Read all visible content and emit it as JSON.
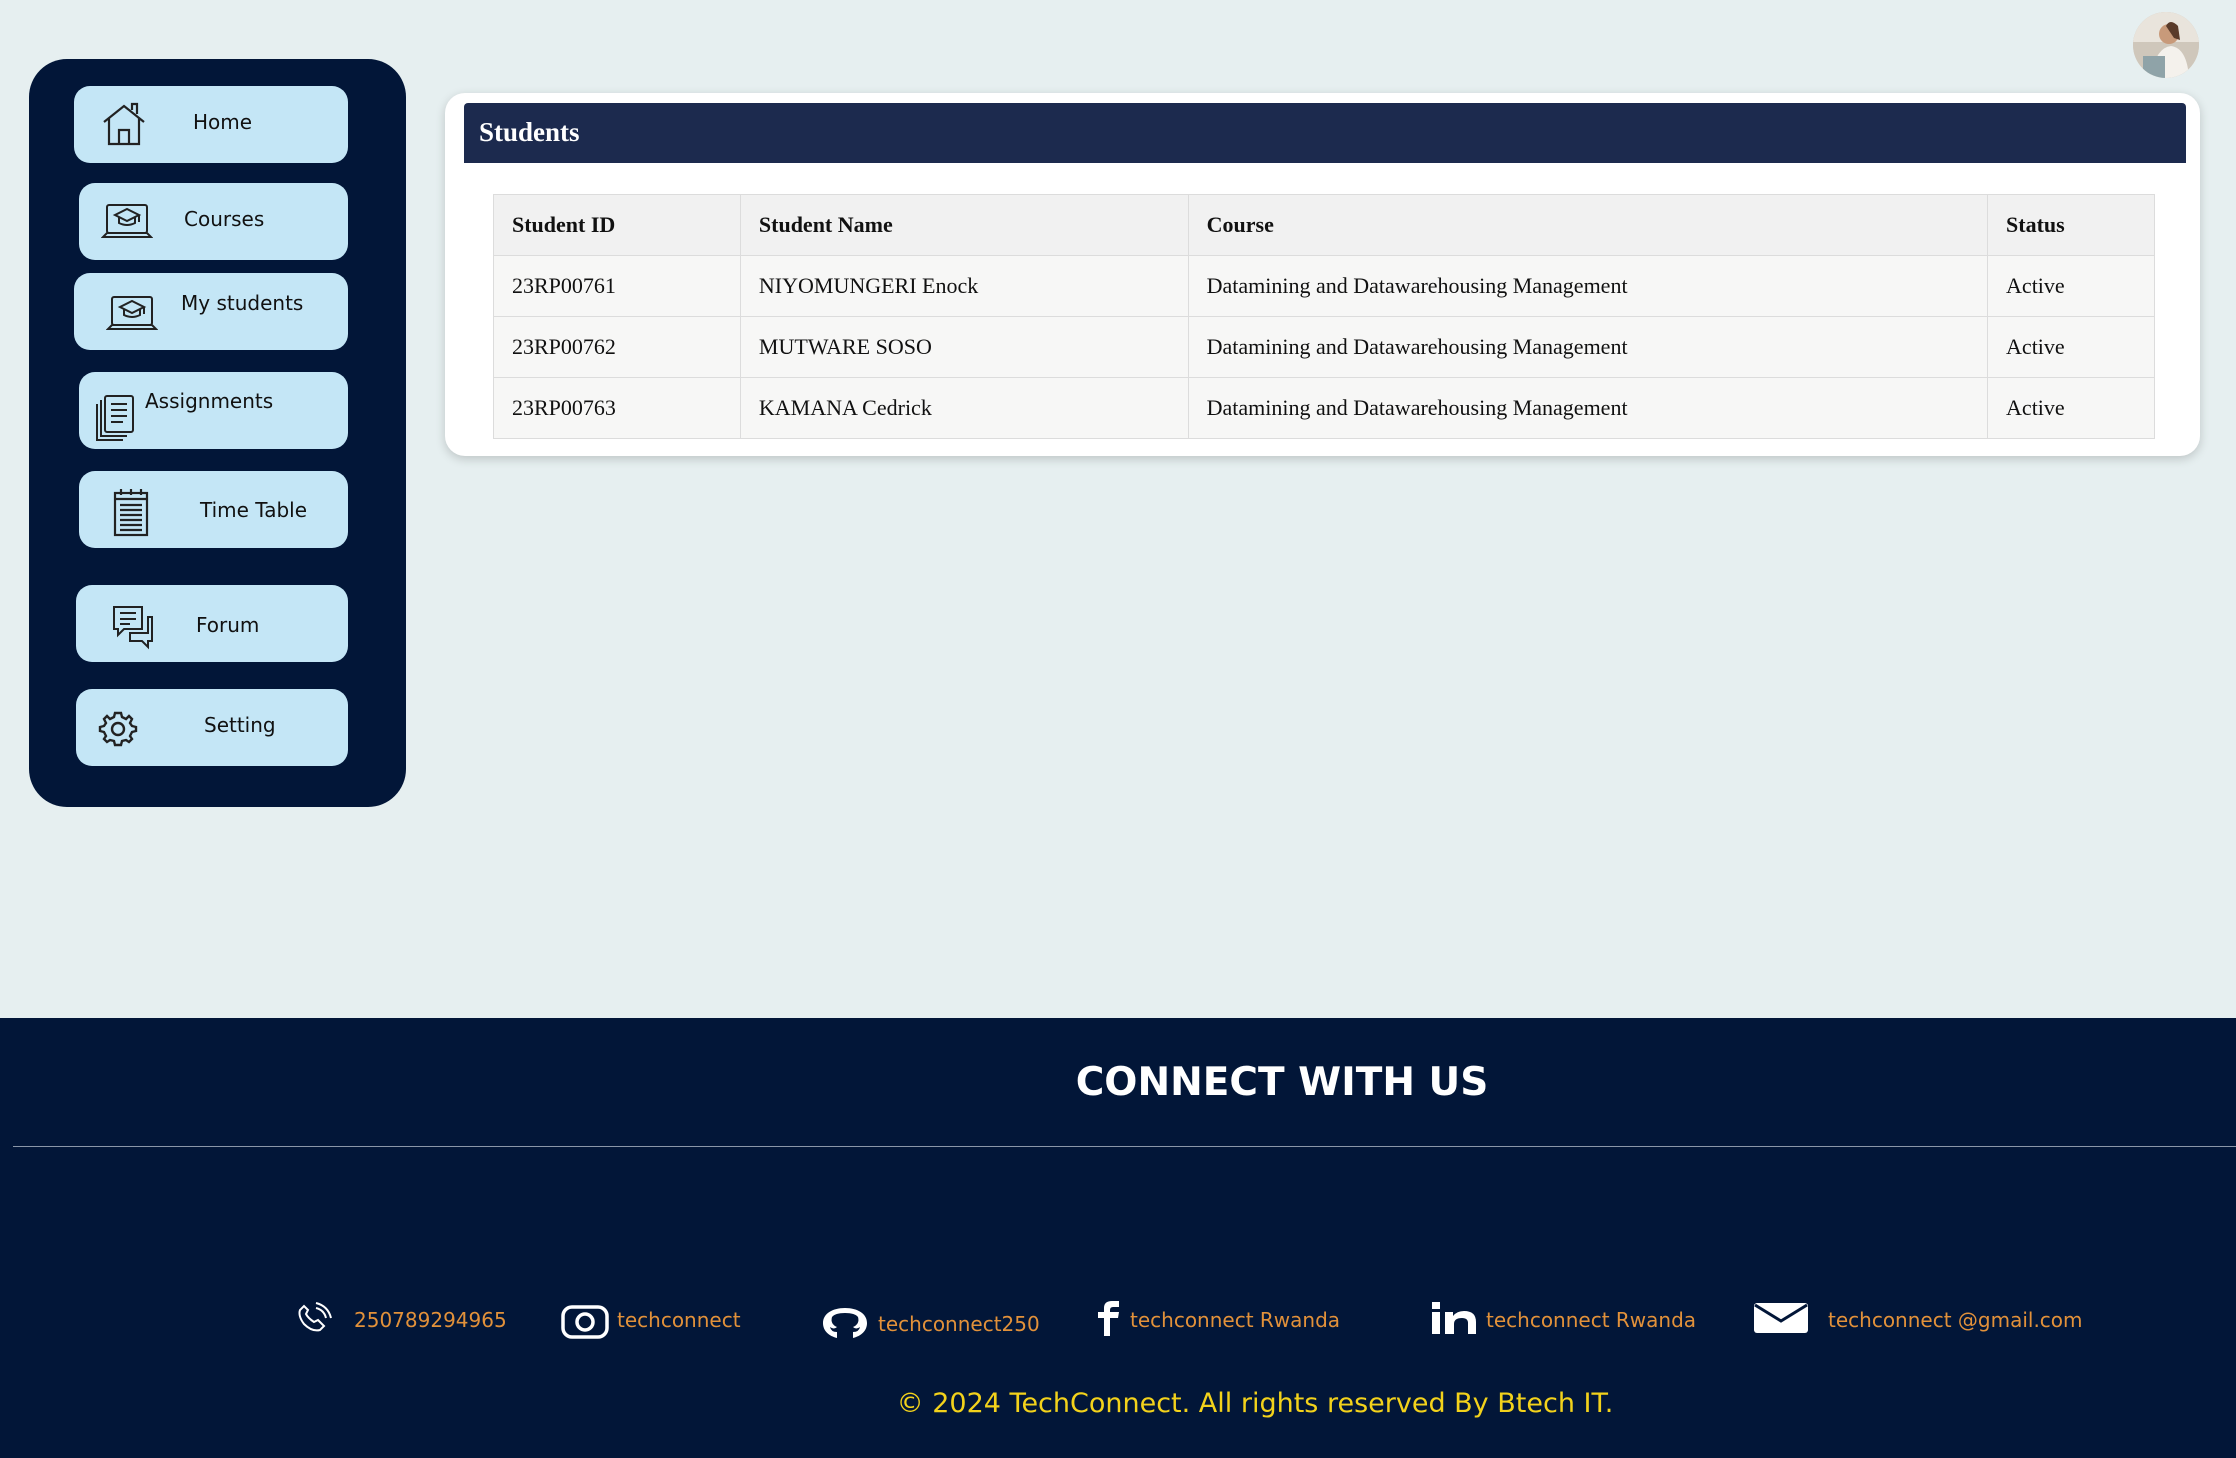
{
  "header": {
    "avatar": "user-avatar"
  },
  "sidebar": {
    "items": [
      {
        "label": "Home",
        "icon": "home-icon"
      },
      {
        "label": "Courses",
        "icon": "courses-icon"
      },
      {
        "label": "My students",
        "icon": "students-icon"
      },
      {
        "label": "Assignments",
        "icon": "assignments-icon"
      },
      {
        "label": "Time Table",
        "icon": "calendar-icon"
      },
      {
        "label": "Forum",
        "icon": "forum-icon"
      },
      {
        "label": "Setting",
        "icon": "gear-icon"
      }
    ]
  },
  "students": {
    "title": "Students",
    "columns": [
      "Student ID",
      "Student Name",
      "Course",
      "Status"
    ],
    "rows": [
      [
        "23RP00761",
        "NIYOMUNGERI Enock",
        "Datamining and Datawarehousing Management",
        "Active"
      ],
      [
        "23RP00762",
        "MUTWARE SOSO",
        "Datamining and Datawarehousing Management",
        "Active"
      ],
      [
        "23RP00763",
        "KAMANA Cedrick",
        "Datamining and Datawarehousing Management",
        "Active"
      ]
    ]
  },
  "footer": {
    "title": "CONNECT WITH US",
    "contacts": [
      {
        "icon": "phone-icon",
        "text": "250789294965"
      },
      {
        "icon": "instagram-icon",
        "text": "techconnect"
      },
      {
        "icon": "github-icon",
        "text": "techconnect250"
      },
      {
        "icon": "facebook-icon",
        "text": "techconnect Rwanda"
      },
      {
        "icon": "linkedin-icon",
        "text": "techconnect Rwanda"
      },
      {
        "icon": "email-icon",
        "text": "techconnect @gmail.com"
      }
    ],
    "copyright": "© 2024 TechConnect. All rights reserved By Btech IT."
  },
  "colors": {
    "sidebar_bg": "#021638",
    "nav_button": "#c4e6f6",
    "panel_header": "#1c2a4e",
    "page_bg": "#e6eff0",
    "contact_text": "#e2913a",
    "copyright_text": "#f3d21b"
  }
}
